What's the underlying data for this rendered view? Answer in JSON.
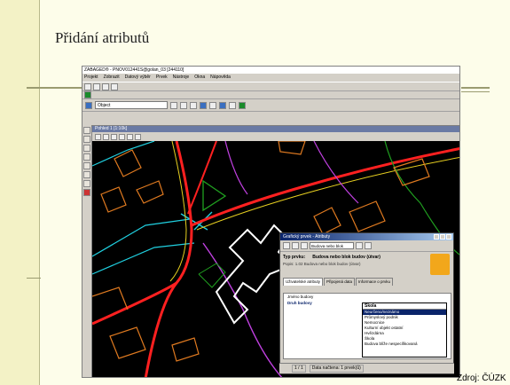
{
  "slide": {
    "title": "Přidání atributů",
    "source": "Zdroj: ČÚZK"
  },
  "app": {
    "window_title": "ZABAGED® - PNOV012441S@golan_03 [244110]",
    "menu": [
      "Projekt",
      "Zobrazit",
      "Datový výběr",
      "Prvek",
      "Nástroje",
      "Okna",
      "Nápověda"
    ],
    "object_combo": "Object",
    "map_window_title": "Pohled 1 [1:10k]"
  },
  "dialog": {
    "title": "Grafický prvek - Atributy",
    "type_combo": "Budova nebo blok",
    "type_label": "Typ prvku:",
    "type_value": "Budova nebo blok budov (útvar)",
    "desc": "Popis: 1.02 Budova nebo blok budov (útvar)",
    "tabs": [
      "Uživatelské atributy",
      "Připojená data",
      "Informace o prvku"
    ],
    "attributes": [
      "Jméno budovy",
      "Druh budovy"
    ],
    "dropdown_header": "Škola",
    "dropdown_items": [
      "Neurčeno/neznámo",
      "Průmyslový podnik",
      "Nemocnice",
      "Kulturní objekt ostatní",
      "Hvězdárna",
      "Škola",
      "Budova blíže nespecifikovaná"
    ],
    "status_pages": "1 / 1",
    "status_text": "Data načtena: 1 prvek(ů)"
  },
  "colors": {
    "map_bg": "#000000",
    "road_red": "#ff2020",
    "building_orange": "#e07a20",
    "selected_white": "#ffffff",
    "water_cyan": "#20d0e0",
    "green": "#20a020"
  }
}
